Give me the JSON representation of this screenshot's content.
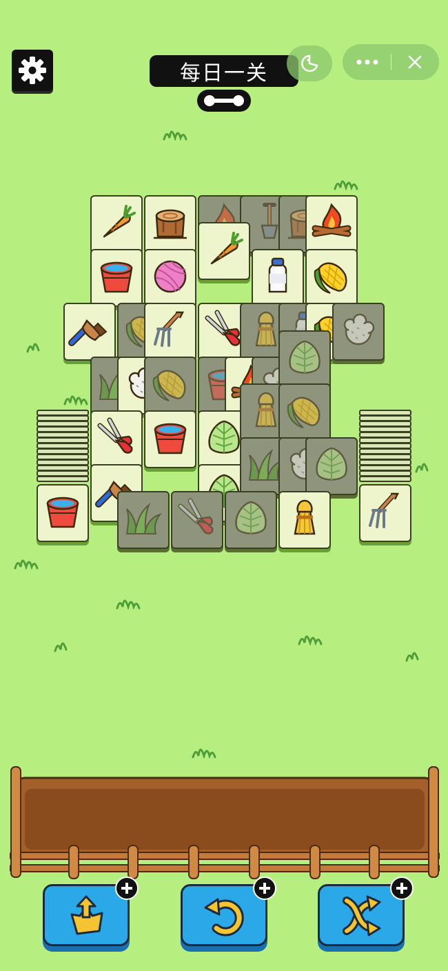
{
  "header": {
    "title": "每日一关"
  },
  "menu": {
    "more_icon": "more-dots-icon",
    "close_icon": "close-icon",
    "game_icon": "pacman-icon"
  },
  "colors": {
    "background": "#b6ef80",
    "tile_face": "#eef5cd",
    "tile_dim": "#8f957c",
    "button_blue": "#2aa8e8",
    "tray_wood": "#a4602a"
  },
  "board": {
    "tiles": [
      {
        "item": "carrot",
        "dim": false
      },
      {
        "item": "stump",
        "dim": false
      },
      {
        "item": "fire",
        "dim": true
      },
      {
        "item": "shovel",
        "dim": true
      },
      {
        "item": "stump",
        "dim": true
      },
      {
        "item": "campfire",
        "dim": false
      },
      {
        "item": "carrot",
        "dim": false
      },
      {
        "item": "bucket",
        "dim": false
      },
      {
        "item": "yarn",
        "dim": false
      },
      {
        "item": "milk",
        "dim": false
      },
      {
        "item": "corn",
        "dim": false
      },
      {
        "item": "brush",
        "dim": false
      },
      {
        "item": "corn",
        "dim": true
      },
      {
        "item": "fork",
        "dim": false
      },
      {
        "item": "shears",
        "dim": false
      },
      {
        "item": "wheat",
        "dim": true
      },
      {
        "item": "milk",
        "dim": true
      },
      {
        "item": "corn",
        "dim": false
      },
      {
        "item": "wool",
        "dim": true
      },
      {
        "item": "grass",
        "dim": true
      },
      {
        "item": "wool",
        "dim": false
      },
      {
        "item": "corn",
        "dim": true
      },
      {
        "item": "bucket",
        "dim": true
      },
      {
        "item": "campfire",
        "dim": false
      },
      {
        "item": "wool",
        "dim": true
      },
      {
        "item": "cabbage",
        "dim": true
      },
      {
        "item": "shears",
        "dim": false
      },
      {
        "item": "bucket",
        "dim": false
      },
      {
        "item": "cabbage",
        "dim": false
      },
      {
        "item": "wheat",
        "dim": true
      },
      {
        "item": "corn",
        "dim": true
      },
      {
        "item": "brush",
        "dim": false
      },
      {
        "item": "cabbage",
        "dim": false
      },
      {
        "item": "grass",
        "dim": true
      },
      {
        "item": "wool",
        "dim": true
      },
      {
        "item": "cabbage",
        "dim": true
      },
      {
        "item": "grass",
        "dim": true
      },
      {
        "item": "shears",
        "dim": true
      },
      {
        "item": "cabbage",
        "dim": true
      },
      {
        "item": "wheat",
        "dim": false
      },
      {
        "item": "bucket",
        "dim": false
      },
      {
        "item": "fork",
        "dim": false
      }
    ]
  },
  "tray": {
    "slots": 7,
    "items": []
  },
  "tools": [
    {
      "name": "move-out",
      "icon": "move-out-icon"
    },
    {
      "name": "undo",
      "icon": "undo-icon"
    },
    {
      "name": "shuffle",
      "icon": "shuffle-icon"
    }
  ]
}
